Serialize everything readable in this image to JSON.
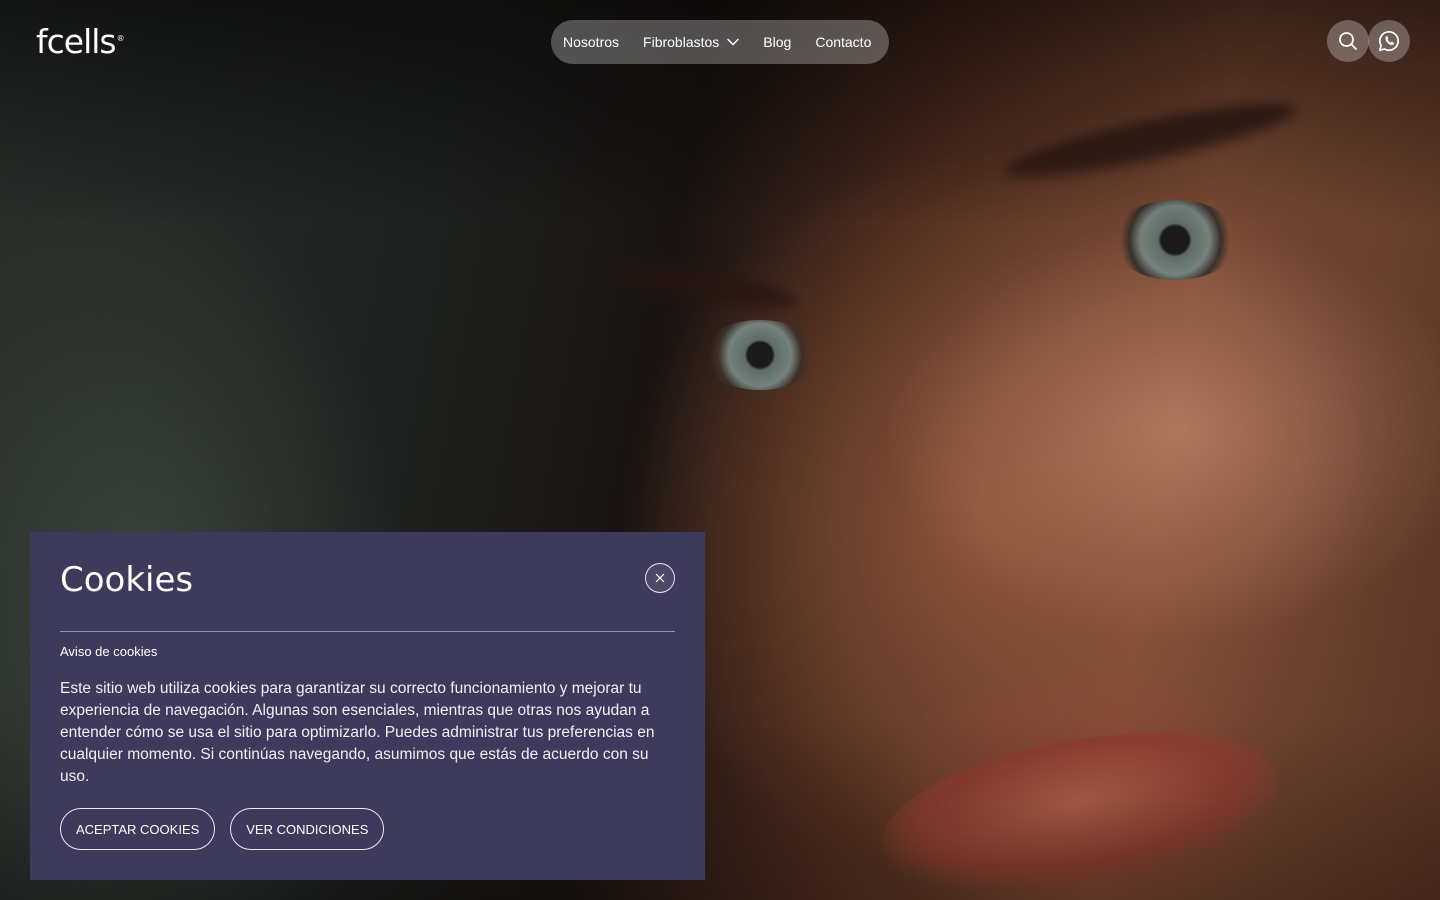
{
  "brand": {
    "logo_text": "fcells",
    "trademark": "®"
  },
  "nav": {
    "items": [
      {
        "label": "Nosotros"
      },
      {
        "label": "Fibroblastos",
        "has_dropdown": true
      },
      {
        "label": "Blog"
      },
      {
        "label": "Contacto"
      }
    ]
  },
  "header_actions": {
    "search_icon": "search-icon",
    "whatsapp_icon": "whatsapp-icon"
  },
  "cookie_banner": {
    "title": "Cookies",
    "subtitle": "Aviso de cookies",
    "body": "Este sitio web utiliza cookies para garantizar su correcto funcionamiento y mejorar tu experiencia de navegación. Algunas son esenciales, mientras que otras nos ayudan a entender cómo se usa el sitio para optimizarlo. Puedes administrar tus preferencias en cualquier momento. Si continúas navegando, asumimos que estás de acuerdo con su uso.",
    "accept_label": "ACEPTAR COOKIES",
    "conditions_label": "VER CONDICIONES",
    "close_icon": "close-icon",
    "background_color": "#3d3a5c"
  }
}
